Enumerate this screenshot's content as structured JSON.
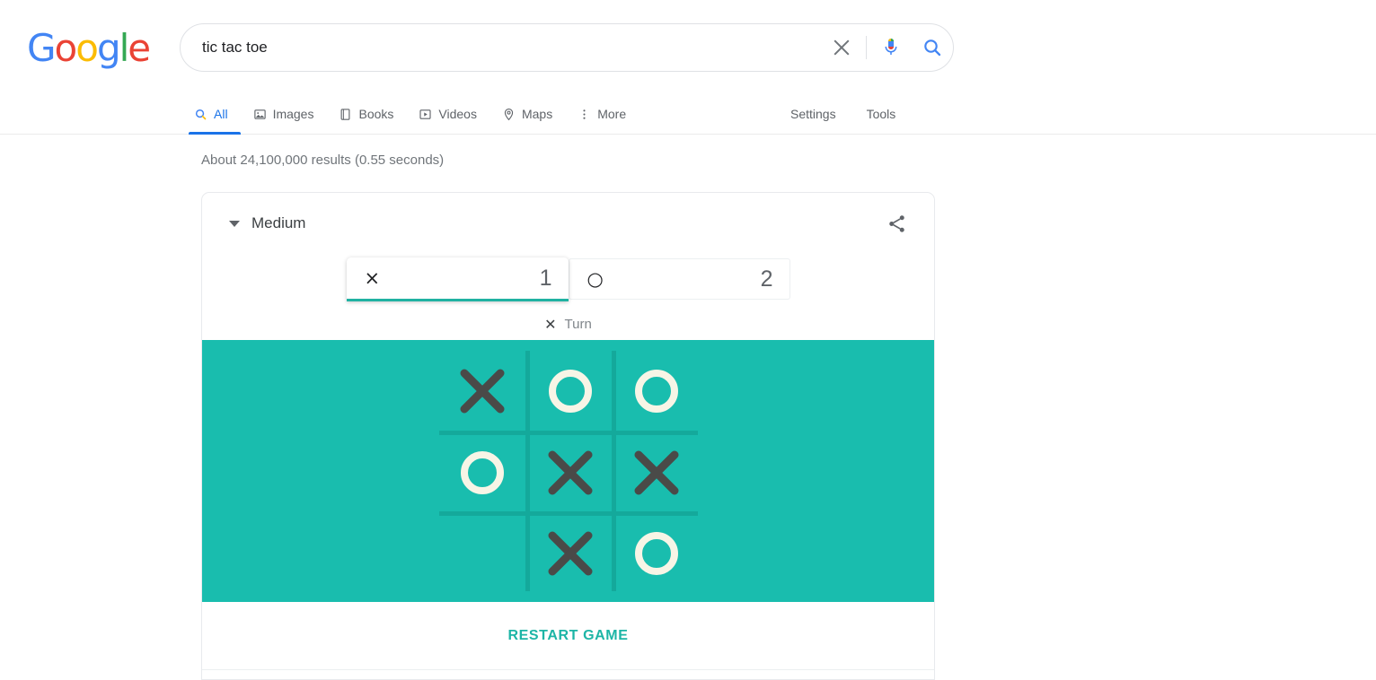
{
  "brand": {
    "logo_letters": [
      {
        "ch": "G",
        "color": "#4285F4"
      },
      {
        "ch": "o",
        "color": "#EA4335"
      },
      {
        "ch": "o",
        "color": "#FBBC05"
      },
      {
        "ch": "g",
        "color": "#4285F4"
      },
      {
        "ch": "l",
        "color": "#34A853"
      },
      {
        "ch": "e",
        "color": "#EA4335"
      }
    ]
  },
  "search": {
    "query": "tic tac toe",
    "placeholder": "Search",
    "clear_icon": "close-icon",
    "mic_icon": "microphone-icon",
    "search_icon": "search-icon"
  },
  "nav": {
    "tabs": [
      {
        "label": "All",
        "icon": "search-icon",
        "active": true
      },
      {
        "label": "Images",
        "icon": "image-icon",
        "active": false
      },
      {
        "label": "Books",
        "icon": "book-icon",
        "active": false
      },
      {
        "label": "Videos",
        "icon": "video-icon",
        "active": false
      },
      {
        "label": "Maps",
        "icon": "map-pin-icon",
        "active": false
      },
      {
        "label": "More",
        "icon": "more-vertical-icon",
        "active": false
      }
    ],
    "settings_label": "Settings",
    "tools_label": "Tools"
  },
  "results": {
    "stats": "About 24,100,000 results (0.55 seconds)"
  },
  "game": {
    "difficulty_label": "Medium",
    "difficulty_caret_icon": "chevron-down-icon",
    "share_icon": "share-icon",
    "scores": [
      {
        "mark": "×",
        "mark_name": "x-mark",
        "value": "1",
        "active": true
      },
      {
        "mark": "○",
        "mark_name": "o-mark",
        "value": "2",
        "active": false
      }
    ],
    "turn": {
      "mark": "✕",
      "label": "Turn"
    },
    "restart_label": "RESTART GAME",
    "colors": {
      "board_background": "#19bdae",
      "grid_line": "#14a99b",
      "x_mark": "#4a4a48",
      "o_mark": "#f7f5e6",
      "accent": "#1db5a6",
      "active_underline": "#20b2a2"
    },
    "board": {
      "rows": [
        [
          "X",
          "O",
          "O"
        ],
        [
          "O",
          "X",
          "X"
        ],
        [
          "",
          "X",
          "O"
        ]
      ]
    }
  }
}
